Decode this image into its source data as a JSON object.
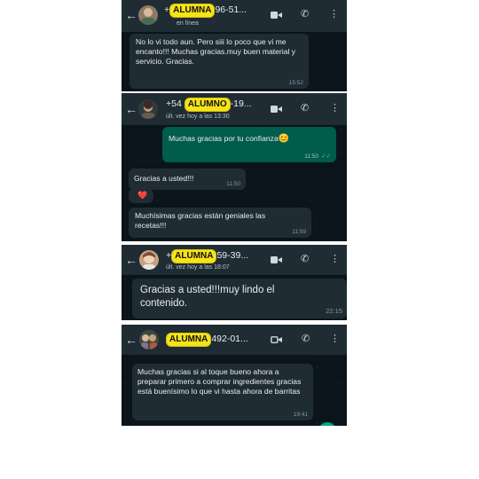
{
  "panels": [
    {
      "contact_prefix": "+",
      "badge": "ALUMNA",
      "contact_suffix": "96-51...",
      "status": "en línea",
      "messages": [
        {
          "text": "No lo vi todo aun. Pero siii lo poco que vi me encanto!!! Muchas gracias.muy buen material y servicio. Gracias.",
          "time": "15:52"
        }
      ]
    },
    {
      "contact_prefix": "+54",
      "badge": "ALUMNO",
      "contact_suffix": "-19...",
      "status": "últ. vez hoy a las 13:30",
      "messages": [
        {
          "text": "Muchas gracias por tu confianza",
          "emoji": "😊",
          "time": "11:50",
          "ticks": "✓✓"
        },
        {
          "text": "Gracias a usted!!!",
          "time": "11:50"
        },
        {
          "text": "❤️"
        },
        {
          "text": "Muchísimas gracias están geniales las recetas!!!",
          "time": "11:59"
        }
      ]
    },
    {
      "contact_prefix": "+",
      "badge": "ALUMNA",
      "contact_suffix": "59-39...",
      "status": "últ. vez hoy a las 18:07",
      "messages": [
        {
          "text": "Gracias a usted!!!muy lindo el contenido.",
          "time": "22:15"
        }
      ]
    },
    {
      "contact_prefix": "",
      "badge": "ALUMNA",
      "contact_suffix": "492-01...",
      "status": "",
      "messages": [
        {
          "text": "Muchas gracias si al toque bueno ahora a preparar primero a comprar ingredientes gracias está buenísimo lo que vi hasta ahora de barritas",
          "time": "19:41"
        }
      ]
    }
  ],
  "icons": {
    "back": "back-arrow-icon",
    "video": "video-camera-icon",
    "call": "phone-icon",
    "menu": "more-vert-icon"
  },
  "colors": {
    "header": "#1f2c34",
    "chat_bg": "#0b141a",
    "incoming": "#1f2c34",
    "outgoing": "#005c4b",
    "badge": "#f6e318"
  }
}
